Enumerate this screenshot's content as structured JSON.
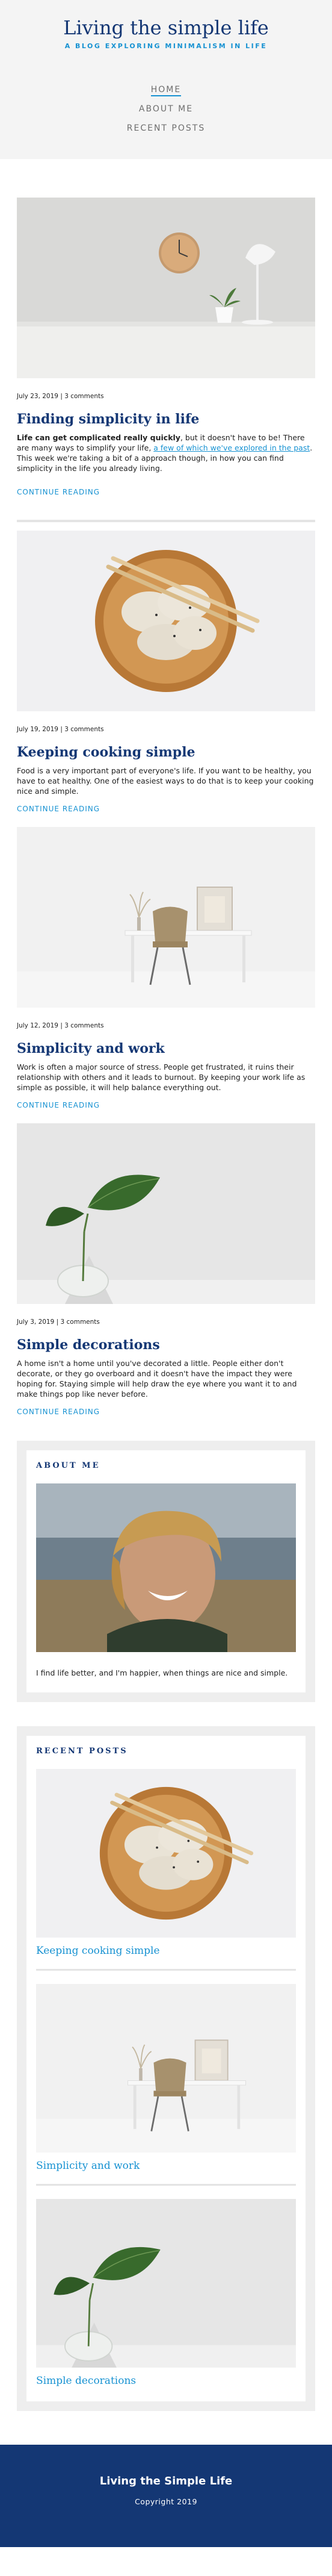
{
  "header": {
    "title": "Living the simple life",
    "tagline": "A BLOG EXPLORING MINIMALISM IN LIFE",
    "nav": [
      "HOME",
      "ABOUT ME",
      "RECENT POSTS"
    ]
  },
  "posts": [
    {
      "meta": "July 23, 2019 | 3 comments",
      "title": "Finding simplicity in life",
      "excerpt_bold": "Life can get complicated really quickly",
      "excerpt_before": ", but it doesn't have to be! There are many ways to simplify your life, ",
      "excerpt_link": "a few of which we've explored in the past",
      "excerpt_after": ". This week we're taking a bit of a approach though, in how you can find simplicity in the life you already living.",
      "more": "CONTINUE READING",
      "image_icon": "clock-desk-lamp-image"
    },
    {
      "meta": "July 19, 2019 | 3 comments",
      "title": "Keeping cooking simple",
      "excerpt": "Food is a very important part of everyone's life. If you want to be healthy, you have to eat healthy. One of the easiest ways to do that is to keep your cooking nice and simple.",
      "more": "CONTINUE READING",
      "image_icon": "dumplings-bowl-image"
    },
    {
      "meta": "July 12, 2019 | 3 comments",
      "title": "Simplicity and work",
      "excerpt": "Work is often a major source of stress. People get frustrated, it ruins their relationship with others and it leads to burnout. By keeping your work life as simple as possible, it will help balance everything out.",
      "more": "CONTINUE READING",
      "image_icon": "desk-chair-image"
    },
    {
      "meta": "July 3, 2019 | 3 comments",
      "title": "Simple decorations",
      "excerpt": "A home isn't a home until you've decorated a little. People either don't decorate, or they go overboard and it doesn't have the impact they were hoping for. Staying simple will help draw the eye where you want it to and make things pop like never before.",
      "more": "CONTINUE READING",
      "image_icon": "plant-vase-image"
    }
  ],
  "about": {
    "title": "ABOUT ME",
    "text": "I find life better, and I'm happier, when things are nice and simple.",
    "image_icon": "smiling-man-portrait"
  },
  "recent": {
    "title": "RECENT POSTS",
    "items": [
      {
        "title": "Keeping cooking simple",
        "image_icon": "dumplings-bowl-image"
      },
      {
        "title": "Simplicity and work",
        "image_icon": "desk-chair-image"
      },
      {
        "title": "Simple decorations",
        "image_icon": "plant-vase-image"
      }
    ]
  },
  "footer": {
    "title": "Living the Simple Life",
    "copyright": "Copyright 2019"
  },
  "colors": {
    "brand_blue": "#143774",
    "accent_blue": "#1792d2",
    "header_bg": "#f4f4f4"
  }
}
